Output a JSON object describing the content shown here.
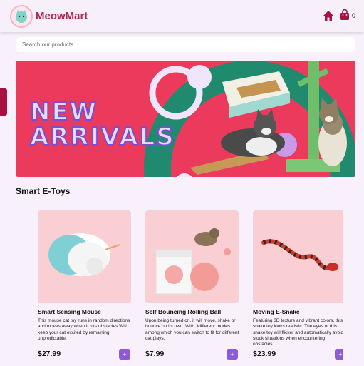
{
  "header": {
    "brand": "MeowMart",
    "cart_count": "0",
    "icons": [
      "cat-logo-icon",
      "home-icon",
      "shopping-bag-icon"
    ]
  },
  "search": {
    "placeholder": "Search our products"
  },
  "banner": {
    "headline_line1": "NEW",
    "headline_line2": "ARRIVALS"
  },
  "section": {
    "title": "Smart E-Toys"
  },
  "products": [
    {
      "title": "Smart Sensing Mouse",
      "desc": "This mouse cat toy runs in random directions and moves away when it hits obstacles.Will keep your cat excited by remaining unpredictable.",
      "price": "$27.99"
    },
    {
      "title": "Self Bouncing Rolling Ball",
      "desc": "Upon being turned on, it will move, shake or bounce on its own. With 3different modes among which you can switch to fit for different cat plays.",
      "price": "$7.99"
    },
    {
      "title": "Moving E-Snake",
      "desc": "Featuring 3D texture and vibrant colors, this snake toy looks realistic. The eyes of this snake toy will flicker and automatically avoid stuck situations when encountering obstacles.",
      "price": "$23.99"
    }
  ],
  "add_label": "+",
  "colors": {
    "brand": "#b0294f",
    "banner": "#ec3a5c",
    "button": "#8e5bd6",
    "card_bg": "#f9cfd4"
  }
}
